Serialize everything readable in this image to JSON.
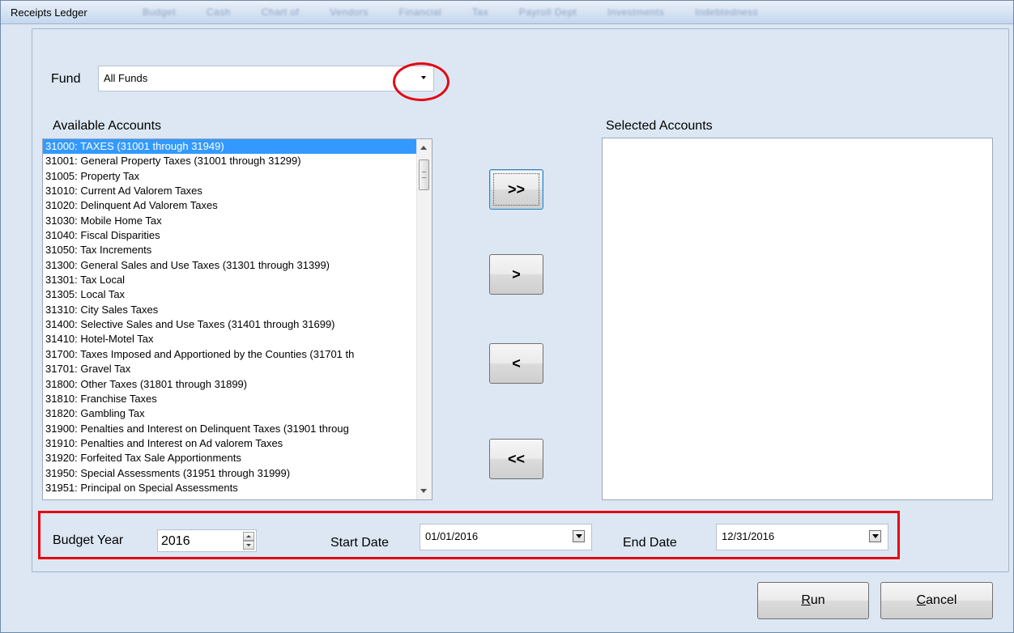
{
  "window": {
    "title": "Receipts Ledger",
    "background_menu_items": [
      "Budget",
      "Cash",
      "Chart of",
      "Vendors",
      "Financial",
      "Tax",
      "Payroll Dept",
      "Investments",
      "Indebtedness"
    ]
  },
  "fund": {
    "label": "Fund",
    "value": "All Funds"
  },
  "available_accounts": {
    "label": "Available Accounts",
    "items": [
      "31000: TAXES (31001 through 31949)",
      "31001: General Property Taxes (31001 through 31299)",
      "31005: Property Tax",
      "31010: Current Ad Valorem Taxes",
      "31020: Delinquent Ad Valorem Taxes",
      "31030: Mobile Home Tax",
      "31040: Fiscal Disparities",
      "31050: Tax Increments",
      "31300: General Sales and Use Taxes (31301 through 31399)",
      "31301: Tax Local",
      "31305: Local Tax",
      "31310: City Sales Taxes",
      "31400: Selective Sales and Use Taxes (31401 through 31699)",
      "31410: Hotel-Motel Tax",
      "31700: Taxes Imposed and Apportioned by the Counties (31701 th",
      "31701: Gravel Tax",
      "31800: Other Taxes (31801 through 31899)",
      "31810: Franchise Taxes",
      "31820: Gambling Tax",
      "31900: Penalties and Interest on Delinquent Taxes (31901 throug",
      "31910: Penalties and Interest on Ad valorem Taxes",
      "31920: Forfeited Tax Sale Apportionments",
      "31950: Special Assessments (31951 through 31999)",
      "31951: Principal on Special Assessments"
    ],
    "selected_index": 0
  },
  "selected_accounts": {
    "label": "Selected Accounts",
    "items": []
  },
  "transfer_buttons": {
    "add_all": ">>",
    "add": ">",
    "remove": "<",
    "remove_all": "<<"
  },
  "budget_year": {
    "label": "Budget Year",
    "value": "2016"
  },
  "start_date": {
    "label": "Start Date",
    "value": "01/01/2016"
  },
  "end_date": {
    "label": "End Date",
    "value": "12/31/2016"
  },
  "footer": {
    "run_label": "Run",
    "cancel_label": "Cancel"
  },
  "colors": {
    "window_bg": "#dce7f3",
    "selection": "#3399ff",
    "annotation": "#e30613"
  },
  "icons": {
    "fund_dropdown": "chevron-down-icon",
    "date_dropdown": "calendar-dropdown-icon",
    "spinner": "spinner-arrows-icon"
  }
}
